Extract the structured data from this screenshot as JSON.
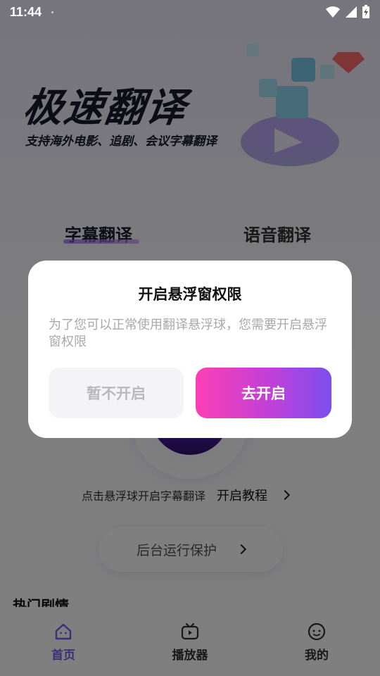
{
  "status_bar": {
    "time": "11:44"
  },
  "hero": {
    "title": "极速翻译",
    "subtitle": "支持海外电影、追剧、会议字幕翻译"
  },
  "tabs": [
    {
      "label": "字幕翻译"
    },
    {
      "label": "语音翻译"
    }
  ],
  "hint": {
    "text": "点击悬浮球开启字幕翻译",
    "link": "开启教程"
  },
  "background_protect": {
    "label": "后台运行保护"
  },
  "hot_section": {
    "title": "热门剧情"
  },
  "bottom_nav": [
    {
      "label": "首页",
      "icon": "home-icon"
    },
    {
      "label": "播放器",
      "icon": "tv-player-icon"
    },
    {
      "label": "我的",
      "icon": "profile-face-icon"
    }
  ],
  "dialog": {
    "title": "开启悬浮窗权限",
    "message": "为了您可以正常使用翻译悬浮球，您需要开启悬浮窗权限",
    "cancel_label": "暂不开启",
    "confirm_label": "去开启"
  },
  "colors": {
    "accent": "#7b5cf0",
    "gradient_start": "#fd3fb4",
    "gradient_end": "#7d4ef0"
  }
}
